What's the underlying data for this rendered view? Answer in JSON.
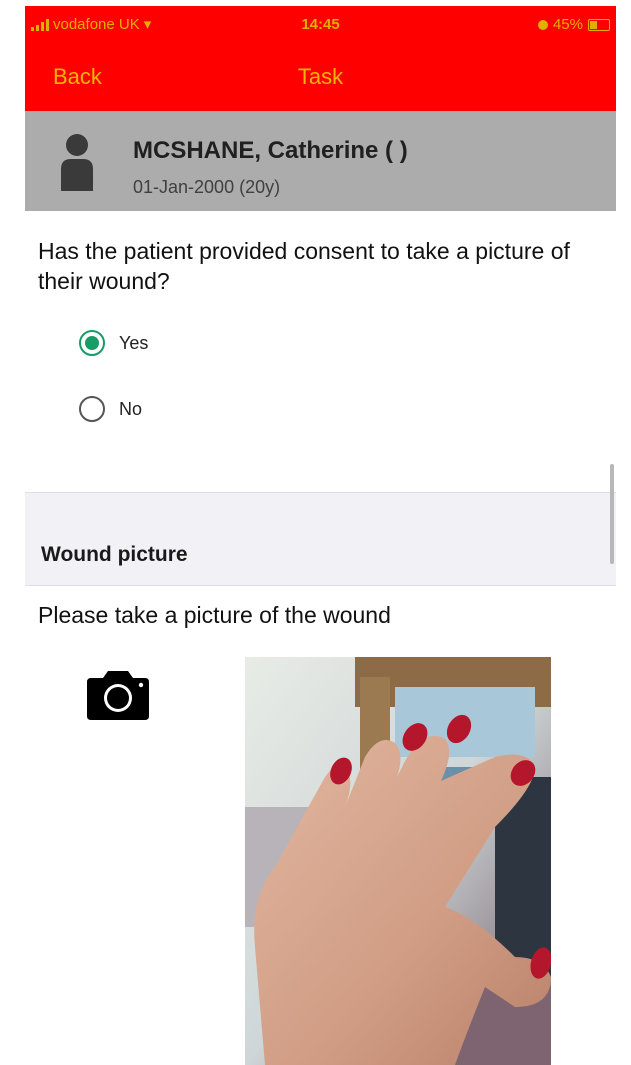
{
  "status_bar": {
    "carrier": "vodafone UK",
    "time": "14:45",
    "battery": "45%",
    "battery_level": 0.45
  },
  "nav": {
    "back_label": "Back",
    "title": "Task"
  },
  "patient": {
    "name": "MCSHANE, Catherine ( )",
    "dob": "01-Jan-2000 (20y)"
  },
  "question": {
    "text": "Has the patient provided consent to take a picture of their wound?",
    "options": [
      {
        "label": "Yes",
        "selected": true
      },
      {
        "label": "No",
        "selected": false
      }
    ]
  },
  "section": {
    "title": "Wound picture",
    "instruction": "Please take a picture of the wound"
  },
  "colors": {
    "header": "#fe0000",
    "header_text": "#f2b500",
    "patient_bar": "#acacac",
    "radio_selected": "#179c66",
    "section_bg": "#f2f2f6"
  },
  "icons": {
    "camera": "camera-icon",
    "avatar": "person-icon"
  }
}
